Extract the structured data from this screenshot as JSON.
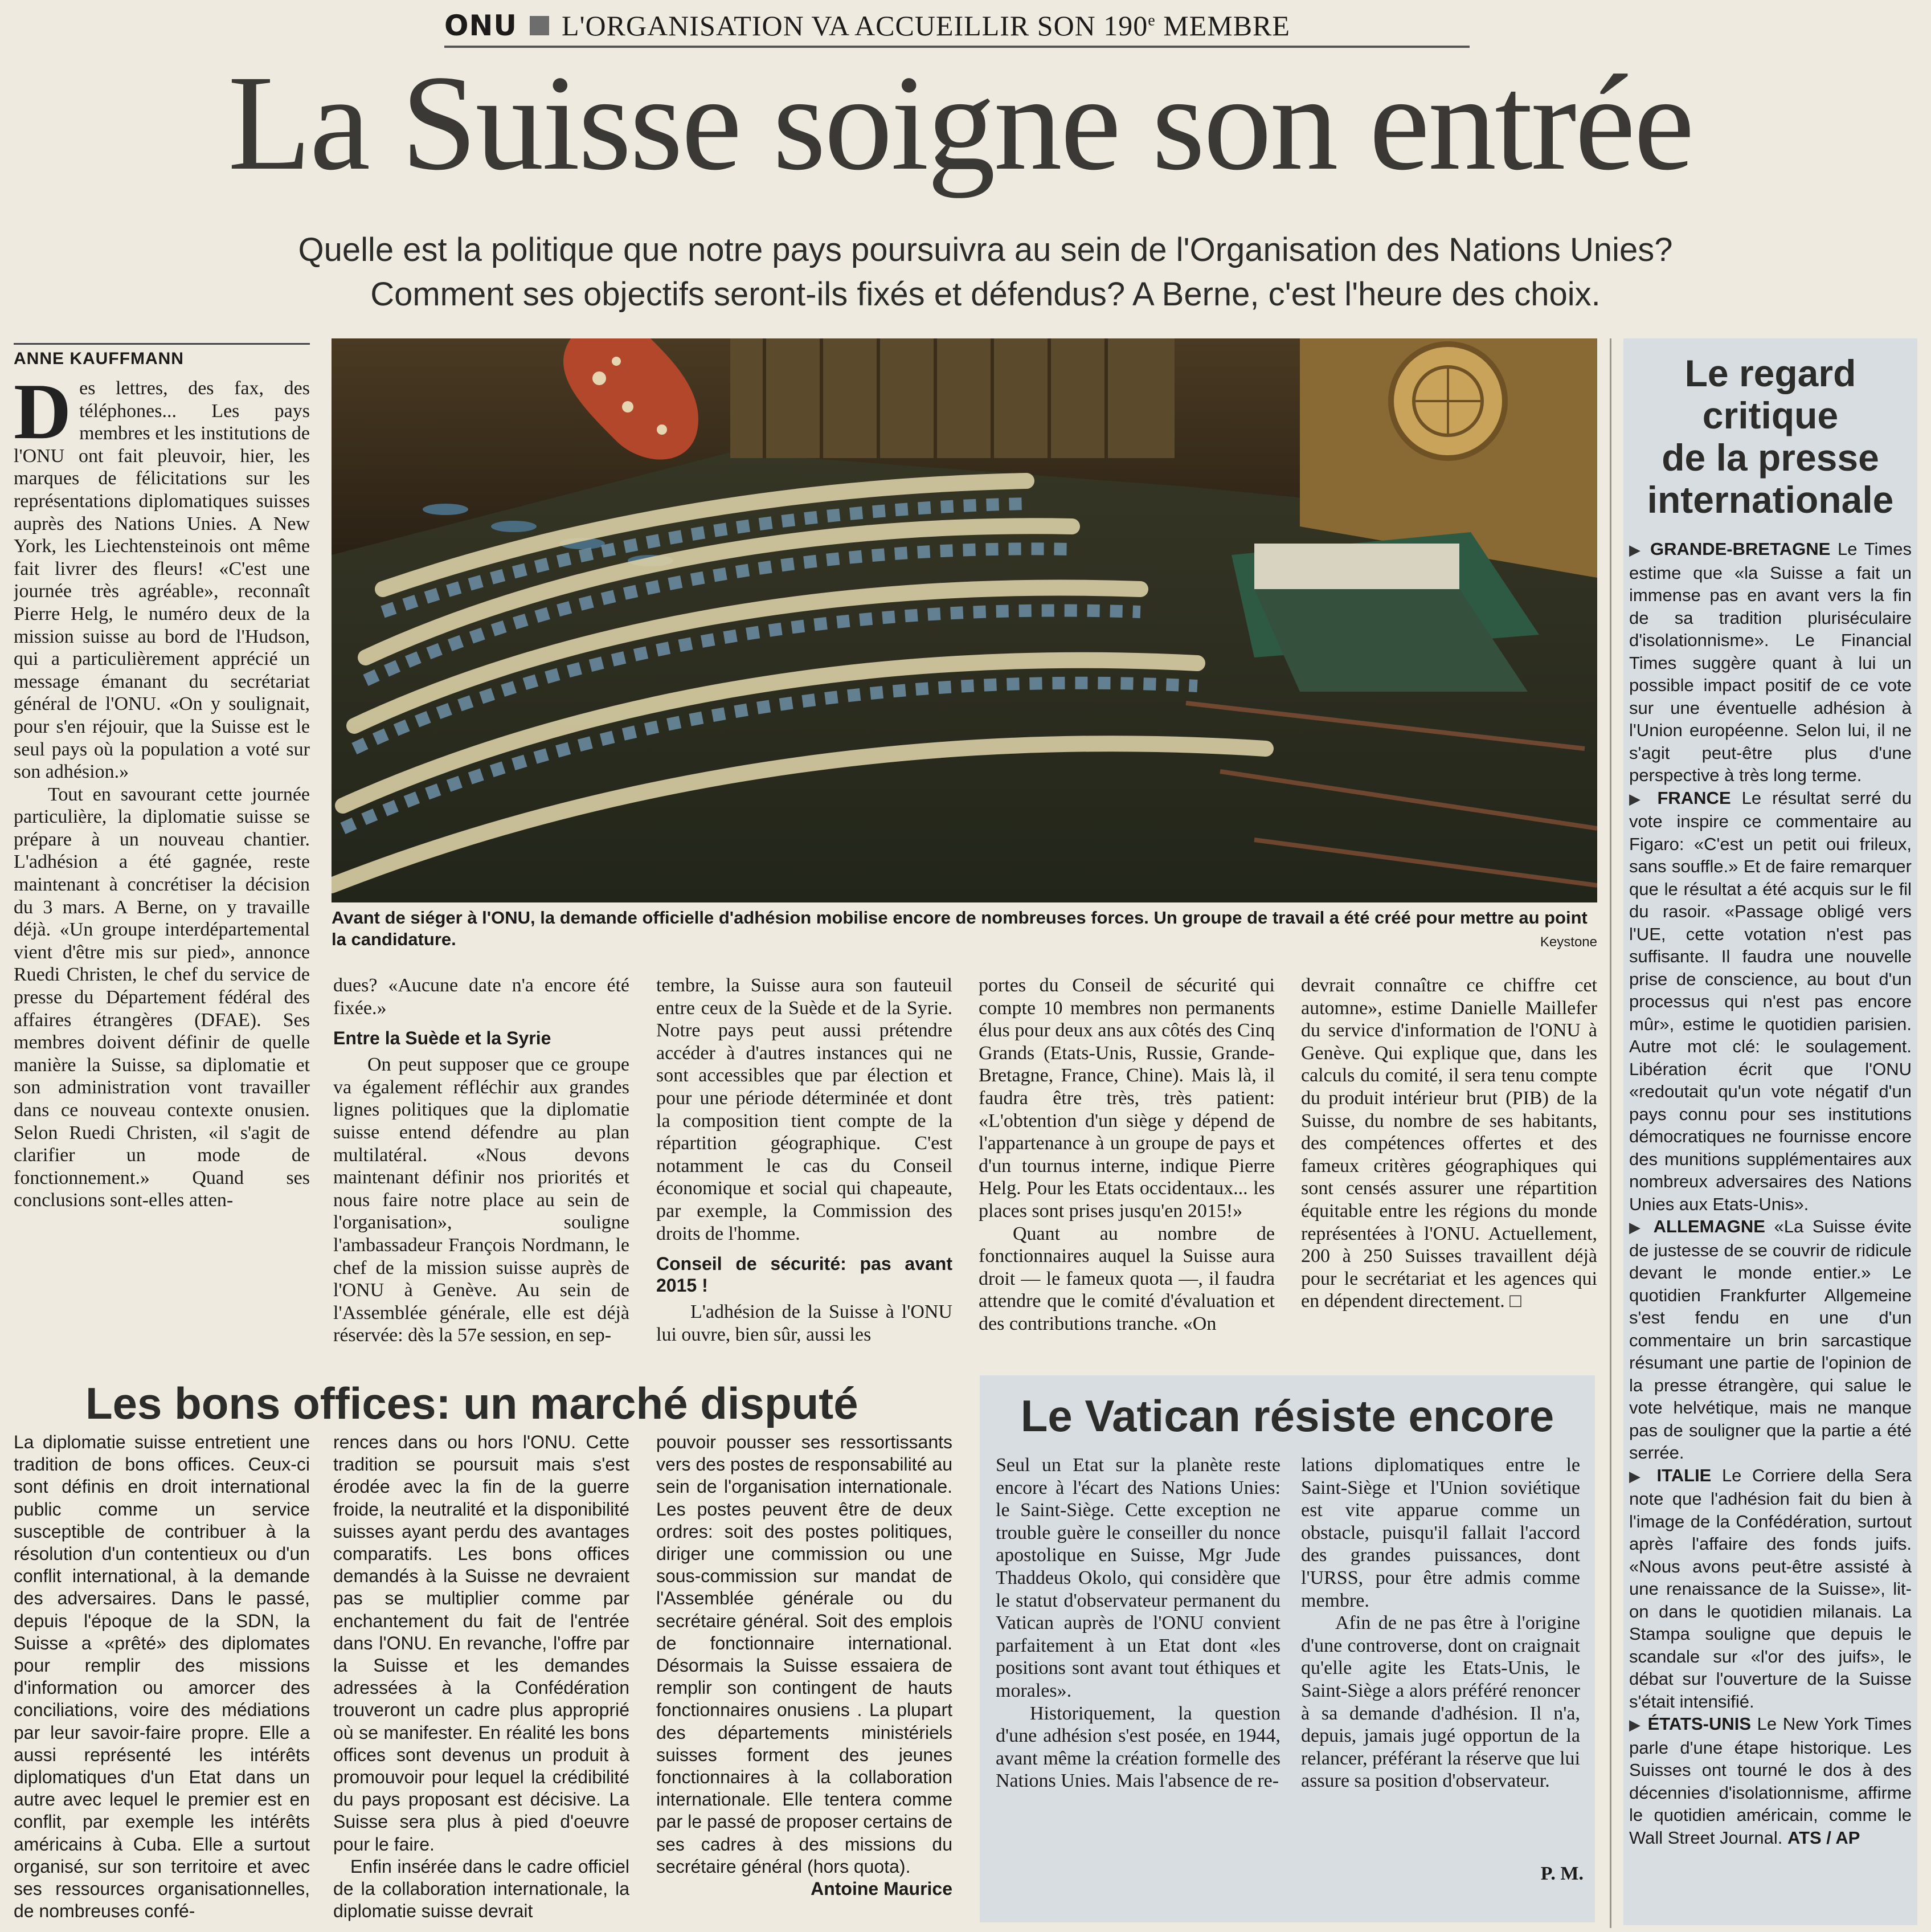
{
  "kicker": {
    "section": "ONU",
    "text": "L'ORGANISATION VA ACCUEILLIR SON 190",
    "sup": "e",
    "text_end": "MEMBRE"
  },
  "headline": "La Suisse soigne son entrée",
  "deck": [
    "Quelle est la politique que notre pays poursuivra au sein de l'Organisation des Nations Unies?",
    "Comment ses objectifs seront-ils fixés et défendus? A Berne, c'est l'heure des choix."
  ],
  "byline": "ANNE KAUFFMANN",
  "main_article": {
    "dropcap": "D",
    "col1": [
      "es lettres, des fax, des téléphones... Les pays membres et les institutions de l'ONU ont fait pleuvoir, hier, les marques de félicitations sur les représentations diplomatiques suisses auprès des Nations Unies. A New York, les Liechtensteinois ont même fait livrer des fleurs! «C'est une journée très agréable», reconnaît Pierre Helg, le numéro deux de la mission suisse au bord de l'Hudson, qui a particulièrement apprécié un message émanant du secrétariat général de l'ONU. «On y soulignait, pour s'en réjouir, que la Suisse est le seul pays où la population a voté sur son adhésion.»",
      "Tout en savourant cette journée particulière, la diplomatie suisse se prépare à un nouveau chantier. L'adhésion a été gagnée, reste maintenant à concrétiser la décision du 3 mars. A Berne, on y travaille déjà. «Un groupe interdépartemental vient d'être mis sur pied», annonce Ruedi Christen, le chef du service de presse du Département fédéral des affaires étrangères (DFAE). Ses membres doivent définir de quelle manière la Suisse, sa diplomatie et son administration vont travailler dans ce nouveau contexte onusien. Selon Ruedi Christen, «il s'agit de clarifier un mode de fonctionnement.» Quand ses conclusions sont-elles atten-"
    ],
    "col2_a": "dues? «Aucune date n'a encore été fixée.»",
    "sub1": "Entre la Suède et la Syrie",
    "col2_b": "On peut supposer que ce groupe va également réfléchir aux grandes lignes politiques que la diplomatie suisse entend défendre au plan multilatéral. «Nous devons maintenant définir nos priorités et nous faire notre place au sein de l'organisation», souligne l'ambassadeur François Nordmann, le chef de la mission suisse auprès de l'ONU à Genève. Au sein de l'Assemblée générale, elle est déjà réservée: dès la 57e session, en sep-",
    "col3_a": "tembre, la Suisse aura son fauteuil entre ceux de la Suède et de la Syrie. Notre pays peut aussi prétendre accéder à d'autres instances qui ne sont accessibles que par élection et pour une période déterminée et dont la composition tient compte de la répartition géographique. C'est notamment le cas du Conseil économique et social qui chapeaute, par exemple, la Commission des droits de l'homme.",
    "sub2": "Conseil de sécurité: pas avant 2015 !",
    "col3_b": "L'adhésion de la Suisse à l'ONU lui ouvre, bien sûr, aussi les",
    "col4": [
      "portes du Conseil de sécurité qui compte 10 membres non permanents élus pour deux ans aux côtés des Cinq Grands (Etats-Unis, Russie, Grande-Bretagne, France, Chine). Mais là, il faudra être très, très patient: «L'obtention d'un siège y dépend de l'appartenance à un groupe de pays et d'un tournus interne, indique Pierre Helg. Pour les Etats occidentaux... les places sont prises jusqu'en 2015!»",
      "Quant au nombre de fonctionnaires auquel la Suisse aura droit — le fameux quota —, il faudra attendre que le comité d'évaluation et des contributions tranche. «On"
    ],
    "col5": "devrait connaître ce chiffre cet automne», estime Danielle Maillefer du service d'information de l'ONU à Genève. Qui explique que, dans les calculs du comité, il sera tenu compte du produit intérieur brut (PIB) de la Suisse, du nombre de ses habitants, des compétences offertes et des fameux critères géographiques qui sont censés assurer une répartition équitable entre les régions du monde représentées à l'ONU. Actuellement, 200 à 250 Suisses travaillent déjà pour le secrétariat et les agences qui en dépendent directement. □"
  },
  "photo": {
    "caption": "Avant de siéger à l'ONU, la demande officielle d'adhésion mobilise encore de nombreuses forces. Un groupe de travail a été créé pour mettre au point la candidature.",
    "credit": "Keystone"
  },
  "bons_offices": {
    "title": "Les bons offices: un marché disputé",
    "col1": "La diplomatie suisse entretient une tradition de bons offices. Ceux-ci sont définis en droit international public comme un service susceptible de contribuer à la résolution d'un contentieux ou d'un conflit international, à la demande des adversaires. Dans le passé, depuis l'époque de la SDN, la Suisse a «prêté» des diplomates pour remplir des missions d'information ou amorcer des conciliations, voire des médiations par leur savoir-faire propre. Elle a aussi représenté les intérêts diplomatiques d'un Etat dans un autre avec lequel le premier est en conflit, par exemple les intérêts américains à Cuba. Elle a surtout organisé, sur son territoire et avec ses ressources organisationnelles, de nombreuses confé-",
    "col2": [
      "rences dans ou hors l'ONU. Cette tradition se poursuit mais s'est érodée avec la fin de la guerre froide, la neutralité et la disponibilité suisses ayant perdu des avantages comparatifs. Les bons offices demandés à la Suisse ne devraient pas se multiplier comme par enchantement du fait de l'entrée dans l'ONU. En revanche, l'offre par la Suisse et les demandes adressées à la Confédération trouveront un cadre plus approprié où se manifester. En réalité les bons offices sont devenus un produit à promouvoir pour lequel la crédibilité du pays proposant est décisive. La Suisse sera plus à pied d'oeuvre pour le faire.",
      "Enfin insérée dans le cadre officiel de la collaboration internationale, la diplomatie suisse devrait"
    ],
    "col3": "pouvoir pousser ses ressortissants vers des postes de responsabilité au sein de l'organisation internationale. Les postes peuvent être de deux ordres: soit des postes politiques, diriger une commission ou une sous-commission sur mandat de l'Assemblée générale ou du secrétaire général. Soit des emplois de fonctionnaire international. Désormais la Suisse essaiera de remplir son contingent de hauts fonctionnaires onusiens . La plupart des départements ministériels suisses forment des jeunes fonctionnaires à la collaboration internationale. Elle tentera comme par le passé de proposer certains de ses cadres à des missions du secrétaire général (hors quota).",
    "signature": "Antoine Maurice"
  },
  "vatican": {
    "title": "Le Vatican résiste encore",
    "col1": [
      "Seul un Etat sur la planète reste encore à l'écart des Nations Unies: le Saint-Siège. Cette exception ne trouble guère le conseiller du nonce apostolique en Suisse, Mgr Jude Thaddeus Okolo, qui considère que le statut d'observateur permanent du Vatican auprès de l'ONU convient parfaitement à un Etat dont «les positions sont avant tout éthiques et morales».",
      "Historiquement, la question d'une adhésion s'est posée, en 1944, avant même la création formelle des Nations Unies. Mais l'absence de re-"
    ],
    "col2": [
      "lations diplomatiques entre le Saint-Siège et l'Union soviétique est vite apparue comme un obstacle, puisqu'il fallait l'accord des grandes puissances, dont l'URSS, pour être admis comme membre.",
      "Afin de ne pas être à l'origine d'une controverse, dont on craignait qu'elle agite les Etats-Unis, le Saint-Siège a alors préféré renoncer à sa demande d'adhésion. Il n'a, depuis, jamais jugé opportun de la relancer, préférant la réserve que lui assure sa position d'observateur."
    ],
    "signature": "P. M."
  },
  "sidebar": {
    "title": [
      "Le regard",
      "critique",
      "de la presse",
      "internationale"
    ],
    "entries": [
      {
        "country": "GRANDE-BRETAGNE",
        "text": "Le Times estime que «la Suisse a fait un immense pas en avant vers la fin de sa tradition pluriséculaire d'isolationnisme». Le Financial Times suggère quant à lui un possible impact positif de ce vote sur une éventuelle adhésion à l'Union européenne. Selon lui, il ne s'agit peut-être plus d'une perspective à très long terme."
      },
      {
        "country": "FRANCE",
        "text": "Le résultat serré du vote inspire ce commentaire au Figaro: «C'est un petit oui frileux, sans souffle.» Et de faire remarquer que le résultat a été acquis sur le fil du rasoir. «Passage obligé vers l'UE, cette votation n'est pas suffisante. Il faudra une nouvelle prise de conscience, au bout d'un processus qui n'est pas encore mûr», estime le quotidien parisien. Autre mot clé: le soulagement. Libération écrit que l'ONU «redoutait qu'un vote négatif d'un pays connu pour ses institutions démocratiques ne fournisse encore des munitions supplémentaires aux nombreux adversaires des Nations Unies aux Etats-Unis»."
      },
      {
        "country": "ALLEMAGNE",
        "text": "«La Suisse évite de justesse de se couvrir de ridicule devant le monde entier.» Le quotidien Frankfurter Allgemeine s'est fendu en une d'un commentaire un brin sarcastique résumant une partie de l'opinion de la presse étrangère, qui salue le vote helvétique, mais ne manque pas de souligner que la partie a été serrée."
      },
      {
        "country": "ITALIE",
        "text": "Le Corriere della Sera note que l'adhésion fait du bien à l'image de la Confédération, surtout après l'affaire des fonds juifs. «Nous avons peut-être assisté à une renaissance de la Suisse», lit-on dans le quotidien milanais. La Stampa souligne que depuis le scandale sur «l'or des juifs», le débat sur l'ouverture de la Suisse s'était intensifié."
      },
      {
        "country": "ÉTATS-UNIS",
        "text": "Le New York Times parle d'une étape historique. Les Suisses ont tourné le dos à des décennies d'isolationnisme, affirme le quotidien américain, comme le Wall Street Journal."
      }
    ],
    "signature": "ATS / AP"
  },
  "colors": {
    "paper": "#eeeadf",
    "sidebar_bg": "#d8dde2",
    "ink": "#1c1b19"
  }
}
